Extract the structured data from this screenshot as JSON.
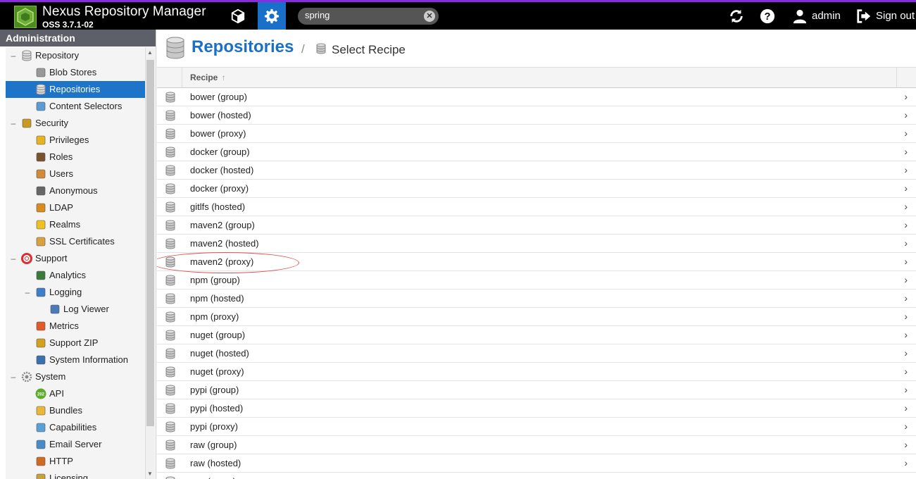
{
  "header": {
    "app_title": "Nexus Repository Manager",
    "app_version": "OSS 3.7.1-02",
    "search_value": "spring",
    "user_label": "admin",
    "signout_label": "Sign out",
    "accent_color": "#1a6fc9",
    "top_border_color": "#8a2be2"
  },
  "sidebar": {
    "title": "Administration",
    "items": [
      {
        "label": "Repository",
        "icon": "database-icon",
        "level": 0,
        "expander": "–"
      },
      {
        "label": "Blob Stores",
        "icon": "blob-store-icon",
        "level": 1
      },
      {
        "label": "Repositories",
        "icon": "database-icon",
        "level": 1,
        "selected": true
      },
      {
        "label": "Content Selectors",
        "icon": "content-selector-icon",
        "level": 1
      },
      {
        "label": "Security",
        "icon": "security-badge-icon",
        "level": 0,
        "expander": "–"
      },
      {
        "label": "Privileges",
        "icon": "medal-icon",
        "level": 1
      },
      {
        "label": "Roles",
        "icon": "role-icon",
        "level": 1
      },
      {
        "label": "Users",
        "icon": "users-icon",
        "level": 1
      },
      {
        "label": "Anonymous",
        "icon": "anonymous-icon",
        "level": 1
      },
      {
        "label": "LDAP",
        "icon": "ldap-book-icon",
        "level": 1
      },
      {
        "label": "Realms",
        "icon": "shield-icon",
        "level": 1
      },
      {
        "label": "SSL Certificates",
        "icon": "certificate-icon",
        "level": 1
      },
      {
        "label": "Support",
        "icon": "lifebuoy-icon",
        "level": 0,
        "expander": "–"
      },
      {
        "label": "Analytics",
        "icon": "analytics-icon",
        "level": 1
      },
      {
        "label": "Logging",
        "icon": "logging-book-icon",
        "level": 1,
        "expander": "–"
      },
      {
        "label": "Log Viewer",
        "icon": "log-viewer-icon",
        "level": 2
      },
      {
        "label": "Metrics",
        "icon": "pie-chart-icon",
        "level": 1
      },
      {
        "label": "Support ZIP",
        "icon": "zip-icon",
        "level": 1
      },
      {
        "label": "System Information",
        "icon": "system-info-icon",
        "level": 1
      },
      {
        "label": "System",
        "icon": "gear-icon",
        "level": 0,
        "expander": "–"
      },
      {
        "label": "API",
        "icon": "api-icon",
        "level": 1
      },
      {
        "label": "Bundles",
        "icon": "puzzle-icon",
        "level": 1
      },
      {
        "label": "Capabilities",
        "icon": "cube-icon",
        "level": 1
      },
      {
        "label": "Email Server",
        "icon": "email-icon",
        "level": 1
      },
      {
        "label": "HTTP",
        "icon": "truck-icon",
        "level": 1
      },
      {
        "label": "Licensing",
        "icon": "license-icon",
        "level": 1
      }
    ]
  },
  "main": {
    "title": "Repositories",
    "breadcrumb_sep": "/",
    "breadcrumb_current": "Select Recipe",
    "column_header": "Recipe",
    "sort_indicator": "↑",
    "rows": [
      "bower (group)",
      "bower (hosted)",
      "bower (proxy)",
      "docker (group)",
      "docker (hosted)",
      "docker (proxy)",
      "gitlfs (hosted)",
      "maven2 (group)",
      "maven2 (hosted)",
      "maven2 (proxy)",
      "npm (group)",
      "npm (hosted)",
      "npm (proxy)",
      "nuget (group)",
      "nuget (hosted)",
      "nuget (proxy)",
      "pypi (group)",
      "pypi (hosted)",
      "pypi (proxy)",
      "raw (group)",
      "raw (hosted)",
      "raw (proxy)"
    ],
    "highlighted_row": "maven2 (proxy)"
  }
}
